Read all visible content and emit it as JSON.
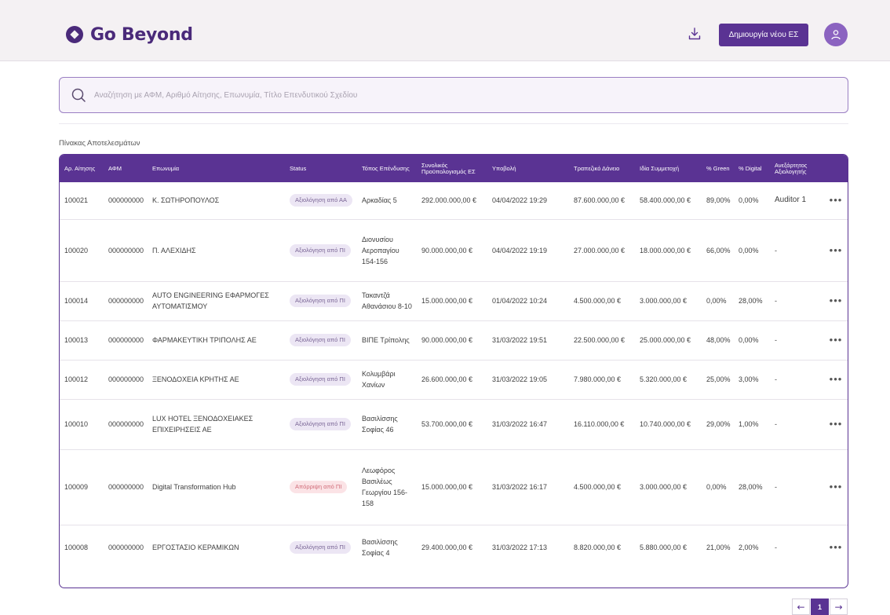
{
  "header": {
    "brand": "Go Beyond",
    "download_icon": "download-icon",
    "create_button": "Δημιουργία νέου ΕΣ",
    "avatar_icon": "user-icon"
  },
  "search": {
    "placeholder": "Αναζήτηση με ΑΦΜ, Αριθμό Αίτησης, Επωνυμία, Τίτλο Επενδυτικού Σχεδίου",
    "value": ""
  },
  "results": {
    "title": "Πίνακας Αποτελεσμάτων",
    "columns": {
      "app_no": "Αρ. Αίτησης",
      "afm": "ΑΦΜ",
      "name": "Επωνυμία",
      "status": "Status",
      "location": "Τόπος Επένδυσης",
      "budget": "Συνολικός Προϋπολογισμός ΕΣ",
      "submission": "Υποβολή",
      "loan": "Τραπεζικό Δάνειο",
      "own": "Ιδία Συμμετοχή",
      "green": "% Green",
      "digital": "% Digital",
      "auditor": "Ανεξάρτητος Αξιολογητής"
    },
    "rows": [
      {
        "app_no": "100021",
        "afm": "000000000",
        "name": "Κ. ΣΩΤΗΡΟΠΟΥΛΟΣ",
        "status": "Αξιολόγηση από ΑΑ",
        "status_kind": "eval",
        "location": "Αρκαδίας 5",
        "budget": "292.000.000,00 €",
        "submission": "04/04/2022 19:29",
        "loan": "87.600.000,00 €",
        "own": "58.400.000,00 €",
        "green": "89,00%",
        "digital": "0,00%",
        "auditor": "Auditor 1"
      },
      {
        "app_no": "100020",
        "afm": "000000000",
        "name": "Π. ΑΛΕΧΙΔΗΣ",
        "status": "Αξιολόγηση από ΠΙ",
        "status_kind": "eval",
        "location": "Διονυσίου Αεροπαγίου 154-156",
        "budget": "90.000.000,00 €",
        "submission": "04/04/2022 19:19",
        "loan": "27.000.000,00 €",
        "own": "18.000.000,00 €",
        "green": "66,00%",
        "digital": "0,00%",
        "auditor": "-"
      },
      {
        "app_no": "100014",
        "afm": "000000000",
        "name": "AUTO ENGINEERING ΕΦΑΡΜΟΓΕΣ ΑΥΤΟΜΑΤΙΣΜΟΥ",
        "status": "Αξιολόγηση από ΠΙ",
        "status_kind": "eval",
        "location": "Τακαντζά Αθανάσιου 8-10",
        "budget": "15.000.000,00 €",
        "submission": "01/04/2022 10:24",
        "loan": "4.500.000,00 €",
        "own": "3.000.000,00 €",
        "green": "0,00%",
        "digital": "28,00%",
        "auditor": "-"
      },
      {
        "app_no": "100013",
        "afm": "000000000",
        "name": "ΦΑΡΜΑΚΕΥΤΙΚΗ ΤΡΙΠΟΛΗΣ ΑΕ",
        "status": "Αξιολόγηση από ΠΙ",
        "status_kind": "eval",
        "location": "ΒΙΠΕ Τρίπολης",
        "budget": "90.000.000,00 €",
        "submission": "31/03/2022 19:51",
        "loan": "22.500.000,00 €",
        "own": "25.000.000,00 €",
        "green": "48,00%",
        "digital": "0,00%",
        "auditor": "-"
      },
      {
        "app_no": "100012",
        "afm": "000000000",
        "name": "ΞΕΝΟΔΟΧΕΙΑ ΚΡΗΤΗΣ ΑΕ",
        "status": "Αξιολόγηση από ΠΙ",
        "status_kind": "eval",
        "location": "Κολυμβάρι Χανίων",
        "budget": "26.600.000,00 €",
        "submission": "31/03/2022 19:05",
        "loan": "7.980.000,00 €",
        "own": "5.320.000,00 €",
        "green": "25,00%",
        "digital": "3,00%",
        "auditor": "-"
      },
      {
        "app_no": "100010",
        "afm": "000000000",
        "name": "LUX HOTEL ΞΕΝΟΔΟΧΕΙΑΚΕΣ ΕΠΙΧΕΙΡΗΣΕΙΣ ΑΕ",
        "status": "Αξιολόγηση από ΠΙ",
        "status_kind": "eval",
        "location": "Βασιλίσσης Σοφίας 46",
        "budget": "53.700.000,00 €",
        "submission": "31/03/2022 16:47",
        "loan": "16.110.000,00 €",
        "own": "10.740.000,00 €",
        "green": "29,00%",
        "digital": "1,00%",
        "auditor": "-"
      },
      {
        "app_no": "100009",
        "afm": "000000000",
        "name": "Digital Transformation Hub",
        "status": "Απόρριψη από ΠΙ",
        "status_kind": "reject",
        "location": "Λεωφόρος Βασιλέως Γεωργίου 156-158",
        "budget": "15.000.000,00 €",
        "submission": "31/03/2022 16:17",
        "loan": "4.500.000,00 €",
        "own": "3.000.000,00 €",
        "green": "0,00%",
        "digital": "28,00%",
        "auditor": "-"
      },
      {
        "app_no": "100008",
        "afm": "000000000",
        "name": "ΕΡΓΟΣΤΑΣΙΟ ΚΕΡΑΜΙΚΩΝ",
        "status": "Αξιολόγηση από ΠΙ",
        "status_kind": "eval",
        "location": "Βασιλίσσης Σοφίας 4",
        "budget": "29.400.000,00 €",
        "submission": "31/03/2022 17:13",
        "loan": "8.820.000,00 €",
        "own": "5.880.000,00 €",
        "green": "21,00%",
        "digital": "2,00%",
        "auditor": "-"
      }
    ],
    "row_action": "•••"
  },
  "pagination": {
    "prev": "←",
    "current": "1",
    "next": "→"
  },
  "colors": {
    "accent": "#5a3393",
    "brand": "#4a2a7a",
    "eval_badge_bg": "#ece6f4",
    "reject_badge_bg": "#fbe3e6"
  }
}
